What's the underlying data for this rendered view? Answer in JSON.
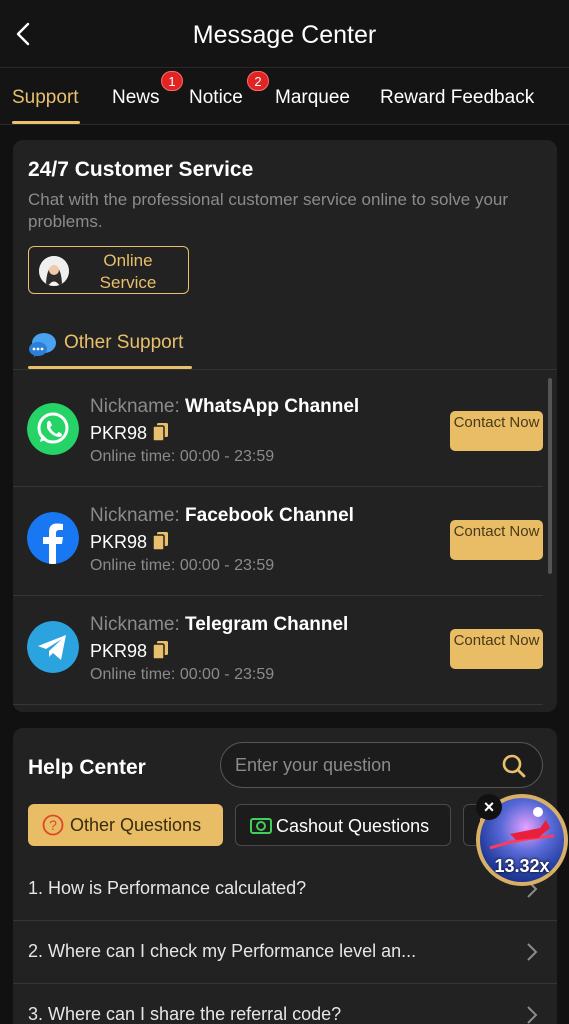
{
  "header": {
    "title": "Message Center"
  },
  "tabs": [
    {
      "label": "Support"
    },
    {
      "label": "News",
      "badge": "1"
    },
    {
      "label": "Notice",
      "badge": "2"
    },
    {
      "label": "Marquee"
    },
    {
      "label": "Reward Feedback"
    }
  ],
  "service": {
    "title": "24/7 Customer Service",
    "description": "Chat with the professional customer service online to solve your problems.",
    "online_button": "Online Service",
    "other_support_label": "Other Support"
  },
  "channels": [
    {
      "nickname_label": "Nickname:",
      "nickname": "WhatsApp Channel",
      "id": "PKR98",
      "online_time": "Online time: 00:00 - 23:59",
      "button": "Contact Now",
      "icon": "whatsapp-icon",
      "color": "#25d366"
    },
    {
      "nickname_label": "Nickname:",
      "nickname": "Facebook Channel",
      "id": "PKR98",
      "online_time": "Online time: 00:00 - 23:59",
      "button": "Contact Now",
      "icon": "facebook-icon",
      "color": "#1877f2"
    },
    {
      "nickname_label": "Nickname:",
      "nickname": "Telegram Channel",
      "id": "PKR98",
      "online_time": "Online time: 00:00 - 23:59",
      "button": "Contact Now",
      "icon": "telegram-icon",
      "color": "#2aa3df"
    }
  ],
  "help": {
    "title": "Help Center",
    "search_placeholder": "Enter your question",
    "tabs": [
      {
        "label": "Other Questions"
      },
      {
        "label": "Cashout Questions"
      }
    ],
    "faqs": [
      "1. How is Performance calculated?",
      "2. Where can I check my Performance level an...",
      "3. Where can I share the referral code?"
    ]
  },
  "floating_widget": {
    "multiplier": "13.32x",
    "close": "×"
  },
  "colors": {
    "accent": "#e9bf6b",
    "background": "#111111",
    "card": "#222222",
    "badge": "#e02424"
  }
}
